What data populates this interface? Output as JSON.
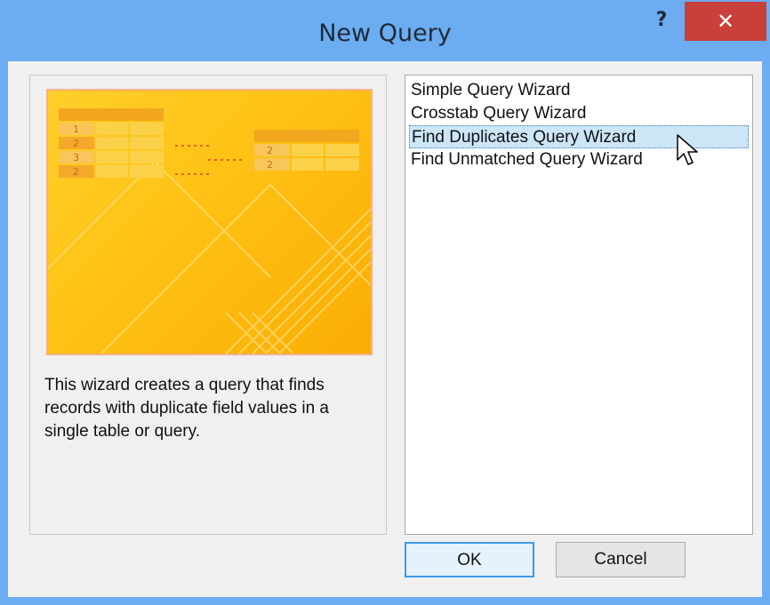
{
  "window": {
    "title": "New Query",
    "help_label": "?",
    "close_label": "✕"
  },
  "preview": {
    "left_table_numbers": [
      "1",
      "2",
      "3",
      "2"
    ],
    "right_table_numbers": [
      "2",
      "2"
    ]
  },
  "description": "This wizard creates a query that finds records with duplicate field values in a single table or query.",
  "wizards": {
    "items": [
      {
        "label": "Simple Query Wizard"
      },
      {
        "label": "Crosstab Query Wizard"
      },
      {
        "label": "Find Duplicates Query Wizard"
      },
      {
        "label": "Find Unmatched Query Wizard"
      }
    ],
    "selected": "Find Duplicates Query Wizard"
  },
  "buttons": {
    "ok": "OK",
    "cancel": "Cancel"
  },
  "icons": {
    "preview": "query-wizard-preview-image",
    "cursor": "mouse-pointer-icon"
  },
  "colors": {
    "title_bar": "#6cacf0",
    "close": "#c9403a",
    "selection": "#cde6f7"
  }
}
